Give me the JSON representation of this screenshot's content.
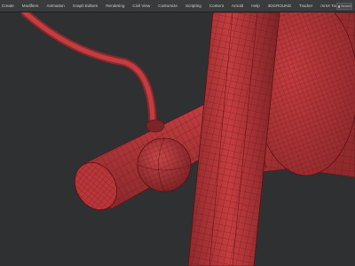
{
  "menubar": {
    "items": [
      {
        "label": "Create"
      },
      {
        "label": "Modifiers"
      },
      {
        "label": "Animation"
      },
      {
        "label": "Graph Editors"
      },
      {
        "label": "Rendering"
      },
      {
        "label": "Civil View"
      },
      {
        "label": "Customize"
      },
      {
        "label": "Scripting"
      },
      {
        "label": "Content"
      },
      {
        "label": "Arnold"
      },
      {
        "label": "Help"
      },
      {
        "label": "3DGROUND"
      },
      {
        "label": "Tracker"
      },
      {
        "label": "mrsX Tools"
      }
    ],
    "search_label": "Search"
  },
  "viewport": {
    "object_color": "#b8373a",
    "wire_color": "#6e1214",
    "background_color": "#2f3032"
  }
}
